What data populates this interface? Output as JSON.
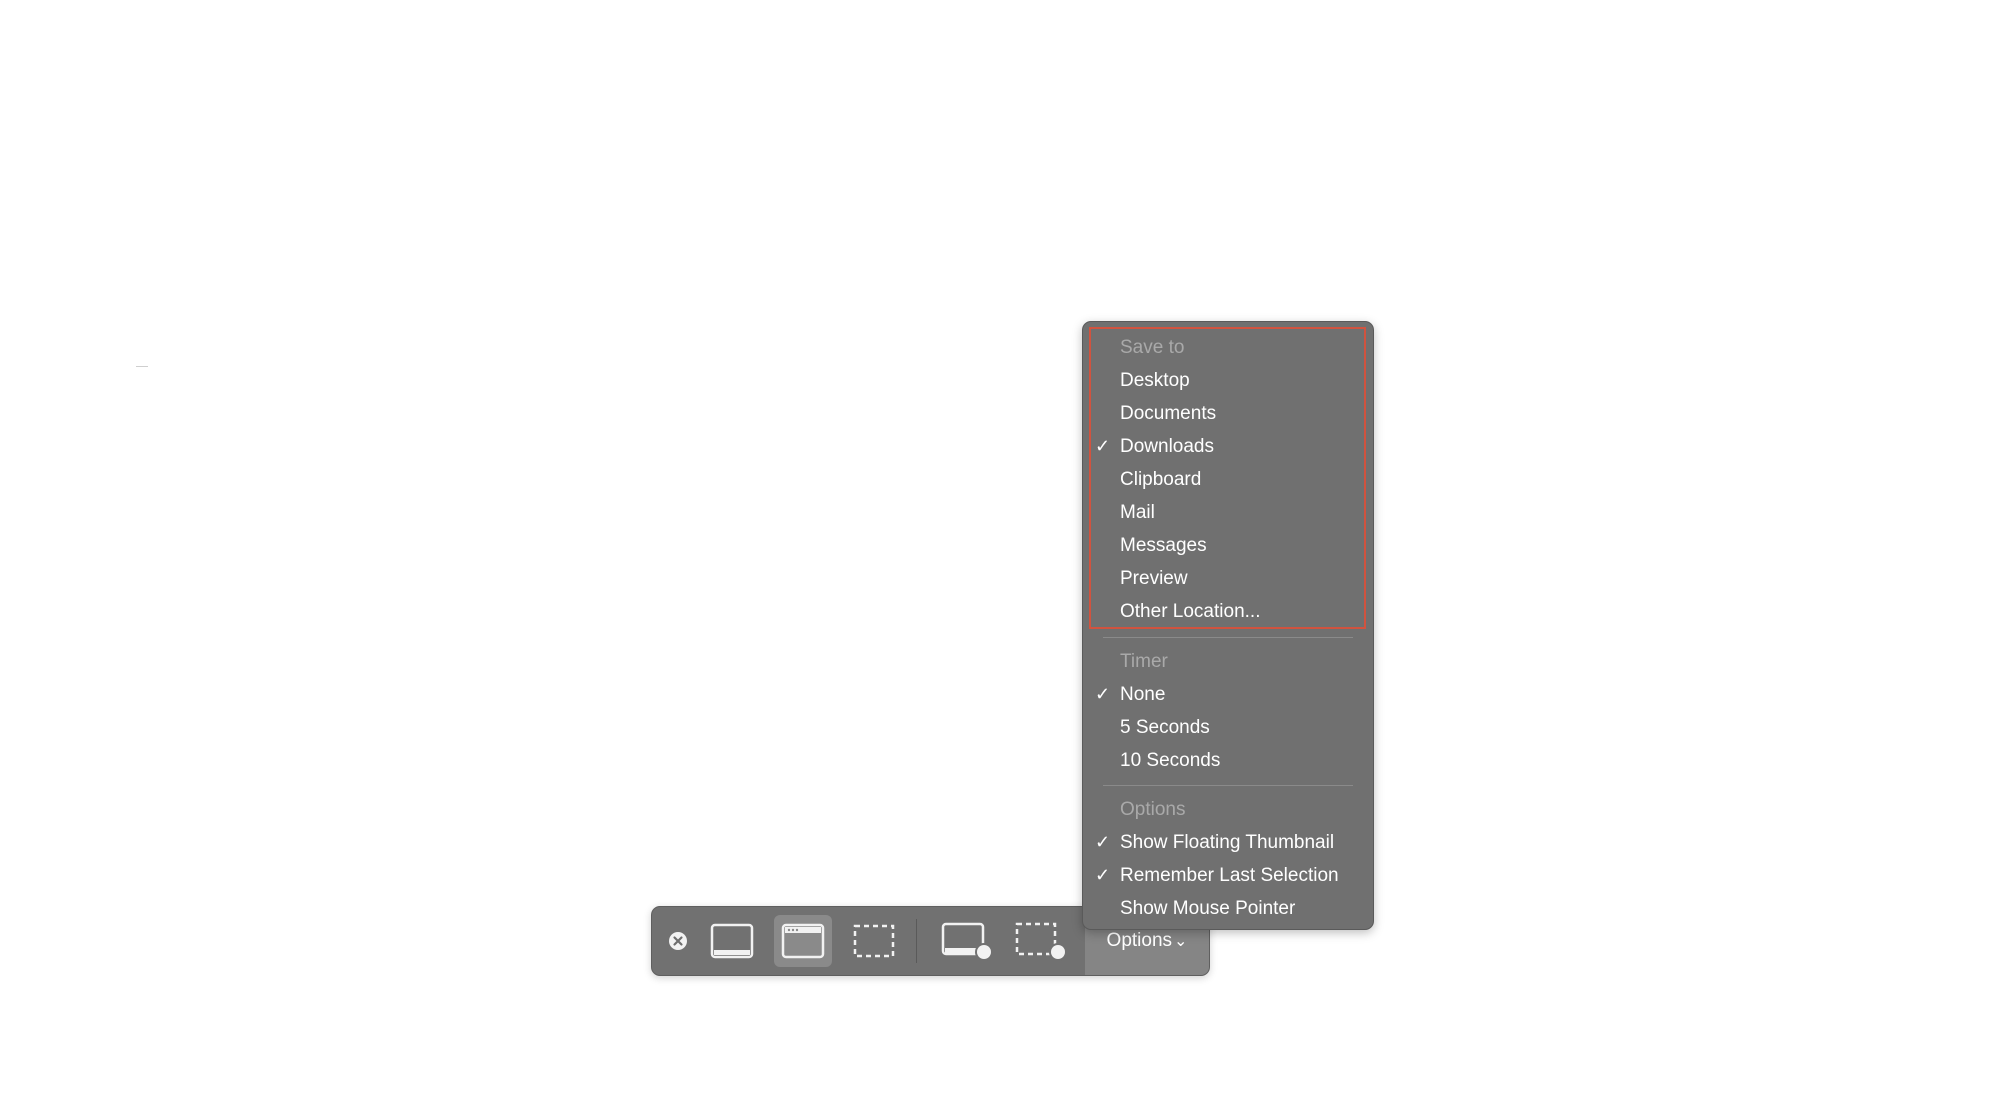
{
  "toolbar": {
    "close_icon": "close-icon",
    "buttons": [
      {
        "icon": "capture-entire-screen-icon"
      },
      {
        "icon": "capture-selected-window-icon",
        "selected": true
      },
      {
        "icon": "capture-selected-portion-icon"
      },
      {
        "icon": "record-entire-screen-icon"
      },
      {
        "icon": "record-selected-portion-icon"
      }
    ],
    "options_label": "Options",
    "options_chevron": "⌄"
  },
  "menu": {
    "save_to": {
      "header": "Save to",
      "items": [
        {
          "label": "Desktop",
          "checked": false
        },
        {
          "label": "Documents",
          "checked": false
        },
        {
          "label": "Downloads",
          "checked": true
        },
        {
          "label": "Clipboard",
          "checked": false
        },
        {
          "label": "Mail",
          "checked": false
        },
        {
          "label": "Messages",
          "checked": false
        },
        {
          "label": "Preview",
          "checked": false
        },
        {
          "label": "Other Location...",
          "checked": false
        }
      ]
    },
    "timer": {
      "header": "Timer",
      "items": [
        {
          "label": "None",
          "checked": true
        },
        {
          "label": "5 Seconds",
          "checked": false
        },
        {
          "label": "10 Seconds",
          "checked": false
        }
      ]
    },
    "options": {
      "header": "Options",
      "items": [
        {
          "label": "Show Floating Thumbnail",
          "checked": true
        },
        {
          "label": "Remember Last Selection",
          "checked": true
        },
        {
          "label": "Show Mouse Pointer",
          "checked": false
        }
      ]
    },
    "check_glyph": "✓",
    "highlight_color": "#d1533f"
  }
}
